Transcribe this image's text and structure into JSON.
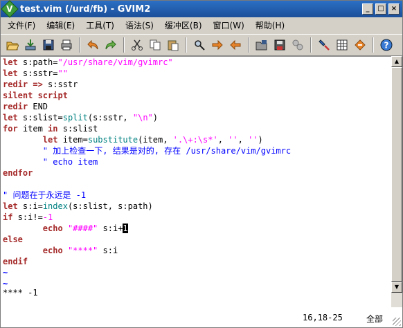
{
  "window": {
    "title": "test.vim (/urd/fb) - GVIM2",
    "icon_letter": "V"
  },
  "title_buttons": {
    "minimize": "_",
    "maximize": "□",
    "close": "×"
  },
  "menu": [
    "文件(F)",
    "编辑(E)",
    "工具(T)",
    "语法(S)",
    "缓冲区(B)",
    "窗口(W)",
    "帮助(H)"
  ],
  "toolbar": {
    "icons": [
      "open-icon",
      "save-icon",
      "save-all-icon",
      "print-icon",
      "undo-icon",
      "redo-icon",
      "cut-icon",
      "copy-icon",
      "paste-icon",
      "find-replace-icon",
      "find-next-icon",
      "find-prev-icon",
      "load-session-icon",
      "save-session-icon",
      "run-script-icon",
      "make-icon",
      "shell-icon",
      "tags-icon",
      "help-icon"
    ]
  },
  "editor": {
    "lines": {
      "l1_a": "let",
      "l1_b": " s:path=",
      "l1_c": "\"/usr/share/vim/gvimrc\"",
      "l2_a": "let",
      "l2_b": " s:sstr=",
      "l2_c": "\"\"",
      "l3_a": "redir",
      "l3_b": " ",
      "l3_c": "=>",
      "l3_d": " s:sstr",
      "l4": "silent script",
      "l5_a": "redir",
      "l5_b": " END",
      "l6_a": "let",
      "l6_b": " s:slist=",
      "l6_c": "split",
      "l6_d": "(s:sstr, ",
      "l6_e": "\"\\n\"",
      "l6_f": ")",
      "l7_a": "for",
      "l7_b": " item ",
      "l7_c": "in",
      "l7_d": " s:slist",
      "l8_a": "        ",
      "l8_b": "let",
      "l8_c": " item=",
      "l8_d": "substitute",
      "l8_e": "(item, ",
      "l8_f": "'.\\+:\\s*'",
      "l8_g": ", ",
      "l8_h": "''",
      "l8_i": ", ",
      "l8_j": "''",
      "l8_k": ")",
      "l9": "        \" 加上检查一下, 结果是对的, 存在 /usr/share/vim/gvimrc",
      "l10": "        \" echo item",
      "l11": "endfor",
      "l12": "",
      "l13": "\" 问题在于永远是 -1",
      "l14_a": "let",
      "l14_b": " s:i=",
      "l14_c": "index",
      "l14_d": "(s:slist, s:path)",
      "l15_a": "if",
      "l15_b": " s:i!=",
      "l15_c": "-1",
      "l16_a": "        ",
      "l16_b": "echo",
      "l16_c": " ",
      "l16_d": "\"####\"",
      "l16_e": " s:i+",
      "l16_f": "1",
      "l17": "else",
      "l18_a": "        ",
      "l18_b": "echo",
      "l18_c": " ",
      "l18_d": "\"****\"",
      "l18_e": " s:i",
      "l19": "endif",
      "l20": "~",
      "l21": "~"
    }
  },
  "cmdline": {
    "message": "**** -1",
    "position": "16,18-25",
    "scroll": "全部"
  }
}
